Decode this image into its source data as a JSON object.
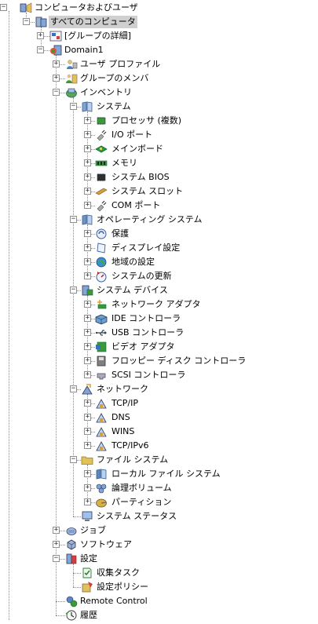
{
  "tree": [
    {
      "label": "コンピュータおよびユーザ",
      "icon": "users-computer-icon",
      "depth": 0,
      "expanded": true
    },
    {
      "label": "すべてのコンピュータ",
      "icon": "all-computers-icon",
      "depth": 1,
      "expanded": true,
      "selected": true
    },
    {
      "label": "[グループの詳細]",
      "icon": "group-details-icon",
      "depth": 2,
      "expanded": false
    },
    {
      "label": "Domain1",
      "icon": "domain-icon",
      "depth": 2,
      "expanded": true
    },
    {
      "label": "ユーザ プロファイル",
      "icon": "user-profile-icon",
      "depth": 3,
      "expanded": false
    },
    {
      "label": "グループのメンバ",
      "icon": "group-members-icon",
      "depth": 3,
      "expanded": false
    },
    {
      "label": "インベントリ",
      "icon": "inventory-icon",
      "depth": 3,
      "expanded": true
    },
    {
      "label": "システム",
      "icon": "system-book-icon",
      "depth": 4,
      "expanded": true
    },
    {
      "label": "プロセッサ (複数)",
      "icon": "processor-icon",
      "depth": 5,
      "expanded": false
    },
    {
      "label": "I/O ポート",
      "icon": "io-port-icon",
      "depth": 5,
      "expanded": false
    },
    {
      "label": "メインボード",
      "icon": "mainboard-icon",
      "depth": 5,
      "expanded": false
    },
    {
      "label": "メモリ",
      "icon": "memory-icon",
      "depth": 5,
      "expanded": false
    },
    {
      "label": "システム BIOS",
      "icon": "bios-chip-icon",
      "depth": 5,
      "expanded": false
    },
    {
      "label": "システム スロット",
      "icon": "system-slot-icon",
      "depth": 5,
      "expanded": false
    },
    {
      "label": "COM ポート",
      "icon": "com-port-icon",
      "depth": 5,
      "expanded": false
    },
    {
      "label": "オペレーティング システム",
      "icon": "operating-system-icon",
      "depth": 4,
      "expanded": true
    },
    {
      "label": "保護",
      "icon": "protection-icon",
      "depth": 5,
      "expanded": false
    },
    {
      "label": "ディスプレイ設定",
      "icon": "display-settings-icon",
      "depth": 5,
      "expanded": false
    },
    {
      "label": "地域の設定",
      "icon": "globe-icon",
      "depth": 5,
      "expanded": false
    },
    {
      "label": "システムの更新",
      "icon": "system-update-icon",
      "depth": 5,
      "expanded": false
    },
    {
      "label": "システム デバイス",
      "icon": "system-devices-icon",
      "depth": 4,
      "expanded": true
    },
    {
      "label": "ネットワーク アダプタ",
      "icon": "network-adapter-icon",
      "depth": 5,
      "expanded": false
    },
    {
      "label": "IDE コントローラ",
      "icon": "ide-controller-icon",
      "depth": 5,
      "expanded": false
    },
    {
      "label": "USB コントローラ",
      "icon": "usb-icon",
      "depth": 5,
      "expanded": false
    },
    {
      "label": "ビデオ アダプタ",
      "icon": "video-adapter-icon",
      "depth": 5,
      "expanded": false
    },
    {
      "label": "フロッピー ディスク コントローラ",
      "icon": "floppy-icon",
      "depth": 5,
      "expanded": false
    },
    {
      "label": "SCSI コントローラ",
      "icon": "scsi-icon",
      "depth": 5,
      "expanded": false
    },
    {
      "label": "ネットワーク",
      "icon": "network-icon",
      "depth": 4,
      "expanded": true
    },
    {
      "label": "TCP/IP",
      "icon": "tcpip-icon",
      "depth": 5,
      "expanded": false
    },
    {
      "label": "DNS",
      "icon": "dns-icon",
      "depth": 5,
      "expanded": false
    },
    {
      "label": "WINS",
      "icon": "wins-icon",
      "depth": 5,
      "expanded": false
    },
    {
      "label": "TCP/IPv6",
      "icon": "tcpipv6-icon",
      "depth": 5,
      "expanded": false
    },
    {
      "label": "ファイル システム",
      "icon": "file-system-icon",
      "depth": 4,
      "expanded": true
    },
    {
      "label": "ローカル ファイル システム",
      "icon": "local-fs-icon",
      "depth": 5,
      "expanded": false
    },
    {
      "label": "論理ボリューム",
      "icon": "logical-volume-icon",
      "depth": 5,
      "expanded": false
    },
    {
      "label": "パーティション",
      "icon": "partition-icon",
      "depth": 5,
      "expanded": false
    },
    {
      "label": "システム ステータス",
      "icon": "system-status-icon",
      "depth": 4,
      "expanded": null
    },
    {
      "label": "ジョブ",
      "icon": "jobs-icon",
      "depth": 3,
      "expanded": false
    },
    {
      "label": "ソフトウェア",
      "icon": "software-icon",
      "depth": 3,
      "expanded": false
    },
    {
      "label": "設定",
      "icon": "settings-icon",
      "depth": 3,
      "expanded": true
    },
    {
      "label": "収集タスク",
      "icon": "collection-task-icon",
      "depth": 4,
      "expanded": null
    },
    {
      "label": "設定ポリシー",
      "icon": "settings-policy-icon",
      "depth": 4,
      "expanded": null
    },
    {
      "label": "Remote Control",
      "icon": "remote-control-icon",
      "depth": 3,
      "expanded": null
    },
    {
      "label": "履歴",
      "icon": "history-icon",
      "depth": 3,
      "expanded": null
    }
  ],
  "colors": {
    "selection": "#cfcfcf",
    "guide": "#8c8c8c",
    "folder": "#e2c15a",
    "book": "#7ea6d8",
    "chip_green": "#3a9a3a",
    "user_blue": "#4a7fc0"
  }
}
